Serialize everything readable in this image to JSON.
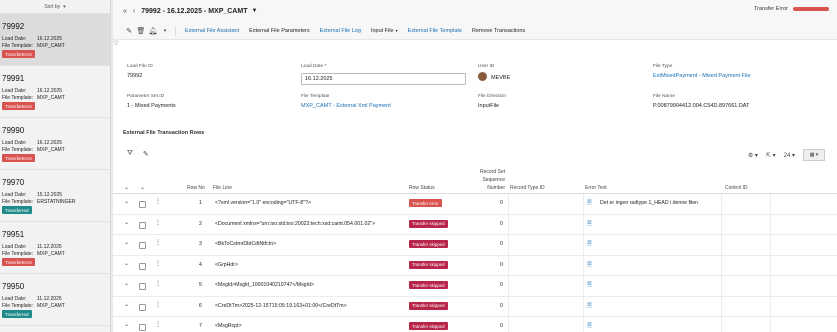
{
  "sidebar": {
    "sort_label": "Sort by",
    "cards": [
      {
        "id": "79992",
        "load_label": "Load Date:",
        "load_date": "16.12.2025",
        "tmpl_label": "File Template:",
        "template": "MXP_CAMT",
        "status": "TransferError",
        "status_type": "err"
      },
      {
        "id": "79991",
        "load_label": "Load Date:",
        "load_date": "16.12.2025",
        "tmpl_label": "File Template:",
        "template": "MXP_CAMT",
        "status": "TransferError",
        "status_type": "err"
      },
      {
        "id": "79990",
        "load_label": "Load Date:",
        "load_date": "16.12.2025",
        "tmpl_label": "File Template:",
        "template": "MXP_CAMT",
        "status": "TransferError",
        "status_type": "err"
      },
      {
        "id": "79970",
        "load_label": "Load Date:",
        "load_date": "15.12.2025",
        "tmpl_label": "File Template:",
        "template": "ERSTATNINGER",
        "status": "Transferred",
        "status_type": "ok"
      },
      {
        "id": "79951",
        "load_label": "Load Date:",
        "load_date": "11.12.2025",
        "tmpl_label": "File Template:",
        "template": "MXP_CAMT",
        "status": "TransferError",
        "status_type": "err"
      },
      {
        "id": "79950",
        "load_label": "Load Date:",
        "load_date": "11.12.2025",
        "tmpl_label": "File Template:",
        "template": "MXP_CAMT",
        "status": "Transferred",
        "status_type": "ok"
      }
    ]
  },
  "header": {
    "title": "79992 - 16.12.2025 - MXP_CAMT",
    "status": "Transfer Error"
  },
  "toolbar": {
    "assistant": "External File Assistant",
    "parameters": "External File Parameters",
    "log": "External File Log",
    "input_file": "Input File",
    "template": "External File Template",
    "remove": "Remove Transactions"
  },
  "fields": {
    "load_file_id_label": "Load File ID",
    "load_file_id": "79992",
    "load_date_label": "Load Date *",
    "load_date": "16.12.2025",
    "user_id_label": "User ID",
    "user_id": "MEVBE",
    "file_type_label": "File Type",
    "file_type": "ExtMixedPayment - Mixed Payment File",
    "param_set_label": "Parameter Set ID",
    "param_set": "1 - Mixed Payments",
    "file_template_label": "File Template",
    "file_template": "MXP_CAMT - External Xml Payment",
    "file_direction_label": "File Direction",
    "file_direction": "InputFile",
    "file_name_label": "File Name",
    "file_name": "P.00879904412.004.C54D.897661.DAT"
  },
  "section_title": "External File Transaction Rows",
  "grid": {
    "page_size": "24"
  },
  "table": {
    "headers": {
      "row_no": "Row No",
      "file_line": "File Line",
      "row_status": "Row Status",
      "rec_set_1": "Record Set",
      "rec_set_2": "Sequence",
      "rec_set_3": "Number",
      "record_type": "Record Type ID",
      "error_text": "Error Text",
      "control_id": "Control ID"
    },
    "rows": [
      {
        "no": "1",
        "line": "<?xml version=\"1.0\" encoding=\"UTF-8\"?>",
        "status": "Transfer error",
        "stype": "err",
        "seq": "0",
        "error": "Det er ingen radtype 1_HEAD i denne filen"
      },
      {
        "no": "2",
        "line": "<Document xmlns=\"urn:iso:std:iso:20022:tech:xsd:camt.054.001.02\">",
        "status": "Transfer skipped",
        "stype": "skip",
        "seq": "0",
        "error": ""
      },
      {
        "no": "3",
        "line": "<BkToCstmrDbtCdtNtfctn>",
        "status": "Transfer skipped",
        "stype": "skip",
        "seq": "0",
        "error": ""
      },
      {
        "no": "4",
        "line": "<GrpHdr>",
        "status": "Transfer skipped",
        "stype": "skip",
        "seq": "0",
        "error": ""
      },
      {
        "no": "5",
        "line": "<MsgId>Msgld_10001040210747</MsgId>",
        "status": "Transfer skipped",
        "stype": "skip",
        "seq": "0",
        "error": ""
      },
      {
        "no": "6",
        "line": "<CreDtTm>2025-12-15T15:05:19.163+01:00</CreDtTm>",
        "status": "Transfer skipped",
        "stype": "skip",
        "seq": "0",
        "error": ""
      },
      {
        "no": "7",
        "line": "<MsgRcpt>",
        "status": "Transfer skipped",
        "stype": "skip",
        "seq": "0",
        "error": ""
      }
    ]
  }
}
